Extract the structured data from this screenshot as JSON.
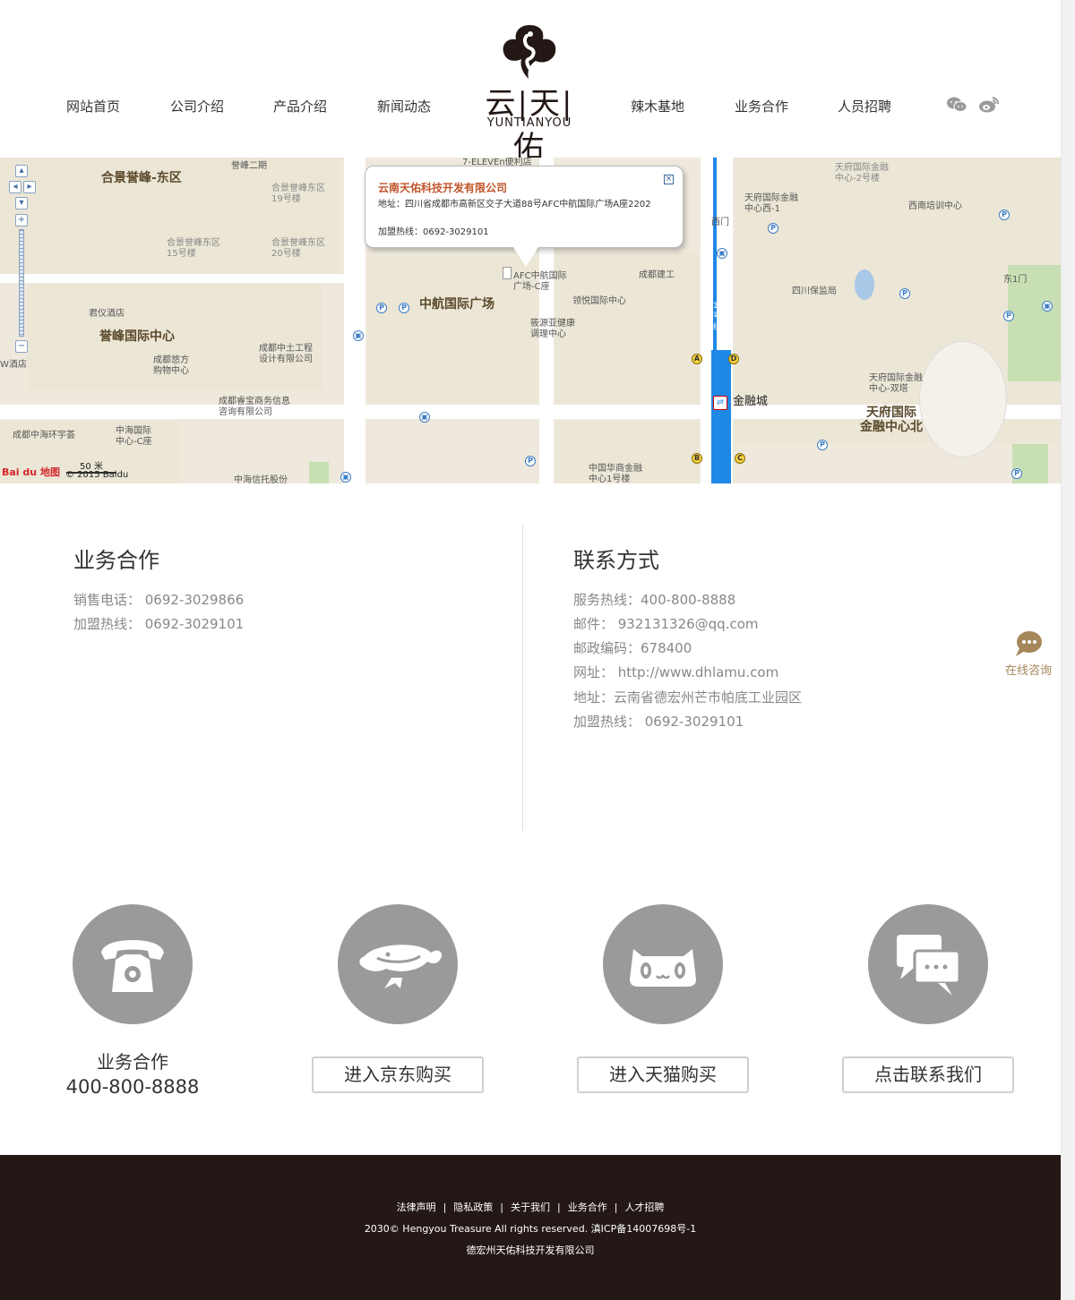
{
  "nav": {
    "items": [
      "网站首页",
      "公司介绍",
      "产品介绍",
      "新闻动态",
      "辣木基地",
      "业务合作",
      "人员招聘"
    ]
  },
  "logo": {
    "cn": "云|天|佑",
    "en": "YUNTIANYOU"
  },
  "social": [
    "wechat-icon",
    "weibo-icon"
  ],
  "map": {
    "info": {
      "title": "云南天佑科技开发有限公司",
      "address": "地址：四川省成都市高新区交子大道88号AFC中航国际广场A座2202",
      "phone": "加盟热线：0692-3029101"
    },
    "labels": {
      "l1": "合景誉峰-东区",
      "l2": "誉峰二期",
      "l3": "7-ELEVEn便利店",
      "l4": "合景誉峰东区\n19号楼",
      "l5": "合景誉峰东区\n15号楼",
      "l6": "合景誉峰东区\n20号楼",
      "l7": "君仪酒店",
      "l8": "誉峰国际中心",
      "l9": "成都悠方\n购物中心",
      "l10": "成都中土工程\n设计有限公司",
      "l11": "成都睿宝商务信息\n咨询有限公司",
      "l12": "中航国际广场",
      "l13": "AFC中航国际\n广场-C座",
      "l14": "领悦国际中心",
      "l15": "成都建工",
      "l16": "筱源亚健康\n调理中心",
      "l17": "成都中海环宇荟",
      "l18": "中海国际\n中心-C座",
      "l19": "中国华商金融\n中心1号楼",
      "l20": "中海信托股份",
      "l21": "金融城",
      "l22": "天府国际金融\n中心西-1",
      "l23": "天府国际金融\n中心-2号楼",
      "l24": "西南培训中心",
      "l25": "西门",
      "l26": "东1门",
      "l27": "四川保监局",
      "l28": "天府国际金融\n中心-双塔",
      "l29": "天府国际\n金融中心北",
      "l30": "1号线",
      "l31": "W酒店"
    },
    "scale": "50 米",
    "copyright": "© 2015 Baidu",
    "brand": "Bai du 地图"
  },
  "business": {
    "title": "业务合作",
    "lines": [
      "销售电话：  0692-3029866",
      "加盟热线：  0692-3029101"
    ]
  },
  "contact": {
    "title": "联系方式",
    "lines": [
      "服务热线：400-800-8888",
      "邮件：  932131326@qq.com",
      "邮政编码：678400",
      "网址：   http://www.dhlamu.com",
      "地址：云南省德宏州芒市帕底工业园区",
      "加盟热线：   0692-3029101"
    ]
  },
  "consult": {
    "label": "在线咨询"
  },
  "actions": {
    "biz_label": "业务合作",
    "biz_phone": "400-800-8888",
    "jd": "进入京东购买",
    "tmall": "进入天猫购买",
    "contact": "点击联系我们"
  },
  "footer": {
    "links": [
      "法律声明",
      "隐私政策",
      "关于我们",
      "业务合作",
      "人才招聘"
    ],
    "separator": "|",
    "copyright": "2030© Hengyou Treasure All rights reserved. 滇ICP备14007698号-1",
    "company": "德宏州天佑科技开发有限公司"
  },
  "colors": {
    "footer_bg": "#231815",
    "icon_circle": "#9a9a9a",
    "info_title": "#c0542a",
    "consult": "#a6875a",
    "metro": "#1e88e5"
  }
}
